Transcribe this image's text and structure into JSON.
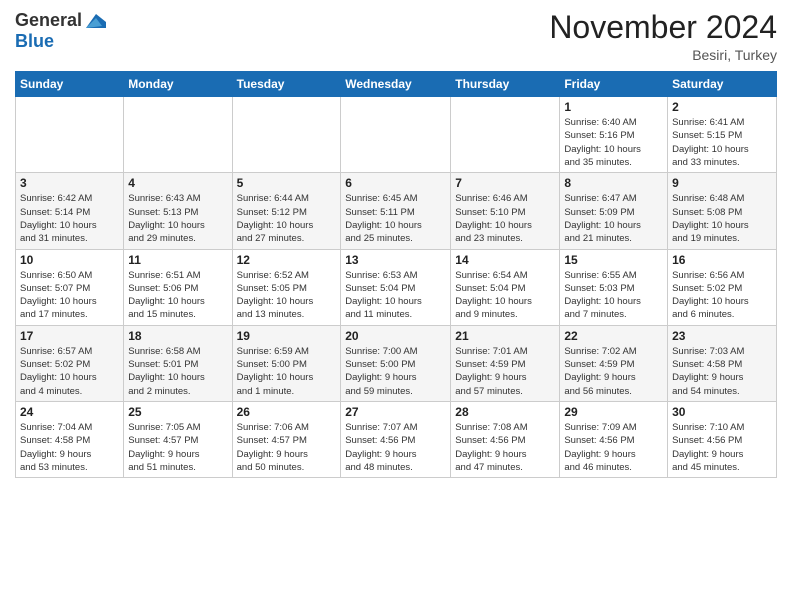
{
  "header": {
    "logo_general": "General",
    "logo_blue": "Blue",
    "month_title": "November 2024",
    "location": "Besiri, Turkey"
  },
  "weekdays": [
    "Sunday",
    "Monday",
    "Tuesday",
    "Wednesday",
    "Thursday",
    "Friday",
    "Saturday"
  ],
  "weeks": [
    [
      {
        "day": "",
        "info": ""
      },
      {
        "day": "",
        "info": ""
      },
      {
        "day": "",
        "info": ""
      },
      {
        "day": "",
        "info": ""
      },
      {
        "day": "",
        "info": ""
      },
      {
        "day": "1",
        "info": "Sunrise: 6:40 AM\nSunset: 5:16 PM\nDaylight: 10 hours\nand 35 minutes."
      },
      {
        "day": "2",
        "info": "Sunrise: 6:41 AM\nSunset: 5:15 PM\nDaylight: 10 hours\nand 33 minutes."
      }
    ],
    [
      {
        "day": "3",
        "info": "Sunrise: 6:42 AM\nSunset: 5:14 PM\nDaylight: 10 hours\nand 31 minutes."
      },
      {
        "day": "4",
        "info": "Sunrise: 6:43 AM\nSunset: 5:13 PM\nDaylight: 10 hours\nand 29 minutes."
      },
      {
        "day": "5",
        "info": "Sunrise: 6:44 AM\nSunset: 5:12 PM\nDaylight: 10 hours\nand 27 minutes."
      },
      {
        "day": "6",
        "info": "Sunrise: 6:45 AM\nSunset: 5:11 PM\nDaylight: 10 hours\nand 25 minutes."
      },
      {
        "day": "7",
        "info": "Sunrise: 6:46 AM\nSunset: 5:10 PM\nDaylight: 10 hours\nand 23 minutes."
      },
      {
        "day": "8",
        "info": "Sunrise: 6:47 AM\nSunset: 5:09 PM\nDaylight: 10 hours\nand 21 minutes."
      },
      {
        "day": "9",
        "info": "Sunrise: 6:48 AM\nSunset: 5:08 PM\nDaylight: 10 hours\nand 19 minutes."
      }
    ],
    [
      {
        "day": "10",
        "info": "Sunrise: 6:50 AM\nSunset: 5:07 PM\nDaylight: 10 hours\nand 17 minutes."
      },
      {
        "day": "11",
        "info": "Sunrise: 6:51 AM\nSunset: 5:06 PM\nDaylight: 10 hours\nand 15 minutes."
      },
      {
        "day": "12",
        "info": "Sunrise: 6:52 AM\nSunset: 5:05 PM\nDaylight: 10 hours\nand 13 minutes."
      },
      {
        "day": "13",
        "info": "Sunrise: 6:53 AM\nSunset: 5:04 PM\nDaylight: 10 hours\nand 11 minutes."
      },
      {
        "day": "14",
        "info": "Sunrise: 6:54 AM\nSunset: 5:04 PM\nDaylight: 10 hours\nand 9 minutes."
      },
      {
        "day": "15",
        "info": "Sunrise: 6:55 AM\nSunset: 5:03 PM\nDaylight: 10 hours\nand 7 minutes."
      },
      {
        "day": "16",
        "info": "Sunrise: 6:56 AM\nSunset: 5:02 PM\nDaylight: 10 hours\nand 6 minutes."
      }
    ],
    [
      {
        "day": "17",
        "info": "Sunrise: 6:57 AM\nSunset: 5:02 PM\nDaylight: 10 hours\nand 4 minutes."
      },
      {
        "day": "18",
        "info": "Sunrise: 6:58 AM\nSunset: 5:01 PM\nDaylight: 10 hours\nand 2 minutes."
      },
      {
        "day": "19",
        "info": "Sunrise: 6:59 AM\nSunset: 5:00 PM\nDaylight: 10 hours\nand 1 minute."
      },
      {
        "day": "20",
        "info": "Sunrise: 7:00 AM\nSunset: 5:00 PM\nDaylight: 9 hours\nand 59 minutes."
      },
      {
        "day": "21",
        "info": "Sunrise: 7:01 AM\nSunset: 4:59 PM\nDaylight: 9 hours\nand 57 minutes."
      },
      {
        "day": "22",
        "info": "Sunrise: 7:02 AM\nSunset: 4:59 PM\nDaylight: 9 hours\nand 56 minutes."
      },
      {
        "day": "23",
        "info": "Sunrise: 7:03 AM\nSunset: 4:58 PM\nDaylight: 9 hours\nand 54 minutes."
      }
    ],
    [
      {
        "day": "24",
        "info": "Sunrise: 7:04 AM\nSunset: 4:58 PM\nDaylight: 9 hours\nand 53 minutes."
      },
      {
        "day": "25",
        "info": "Sunrise: 7:05 AM\nSunset: 4:57 PM\nDaylight: 9 hours\nand 51 minutes."
      },
      {
        "day": "26",
        "info": "Sunrise: 7:06 AM\nSunset: 4:57 PM\nDaylight: 9 hours\nand 50 minutes."
      },
      {
        "day": "27",
        "info": "Sunrise: 7:07 AM\nSunset: 4:56 PM\nDaylight: 9 hours\nand 48 minutes."
      },
      {
        "day": "28",
        "info": "Sunrise: 7:08 AM\nSunset: 4:56 PM\nDaylight: 9 hours\nand 47 minutes."
      },
      {
        "day": "29",
        "info": "Sunrise: 7:09 AM\nSunset: 4:56 PM\nDaylight: 9 hours\nand 46 minutes."
      },
      {
        "day": "30",
        "info": "Sunrise: 7:10 AM\nSunset: 4:56 PM\nDaylight: 9 hours\nand 45 minutes."
      }
    ]
  ]
}
